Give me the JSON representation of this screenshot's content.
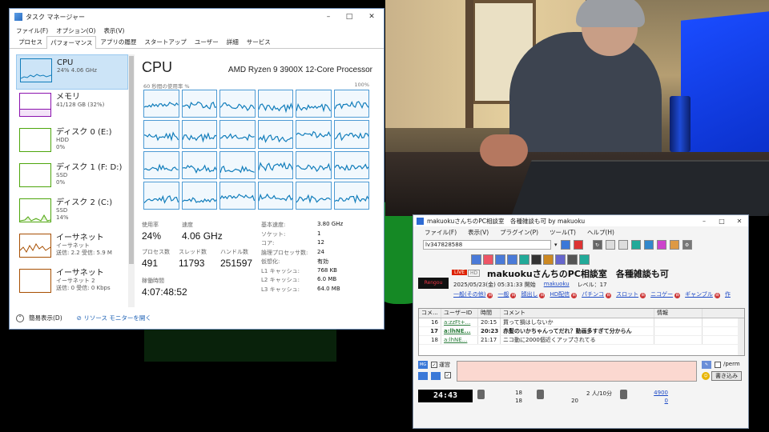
{
  "task_manager": {
    "window_title": "タスク マネージャー",
    "window_controls": {
      "minimize": "–",
      "maximize": "□",
      "close": "✕"
    },
    "menu": [
      "ファイル(F)",
      "オプション(O)",
      "表示(V)"
    ],
    "tabs": [
      "プロセス",
      "パフォーマンス",
      "アプリの履歴",
      "スタートアップ",
      "ユーザー",
      "詳細",
      "サービス"
    ],
    "active_tab": "パフォーマンス",
    "resources": [
      {
        "name": "CPU",
        "sub1": "24% 4.06 GHz",
        "sub2": "",
        "sub3": "",
        "color": "#117dbb"
      },
      {
        "name": "メモリ",
        "sub1": "41/128 GB (32%)",
        "sub2": "",
        "sub3": "",
        "color": "#8b12ae"
      },
      {
        "name": "ディスク 0 (E:)",
        "sub1": "HDD",
        "sub2": "0%",
        "sub3": "",
        "color": "#4da60c"
      },
      {
        "name": "ディスク 1 (F: D:)",
        "sub1": "SSD",
        "sub2": "0%",
        "sub3": "",
        "color": "#4da60c"
      },
      {
        "name": "ディスク 2 (C:)",
        "sub1": "SSD",
        "sub2": "14%",
        "sub3": "",
        "color": "#4da60c"
      },
      {
        "name": "イーサネット",
        "sub1": "イーサネット",
        "sub2": "送信: 2.2  受信: 5.9 M",
        "sub3": "",
        "color": "#a74f01"
      },
      {
        "name": "イーサネット",
        "sub1": "イーサネット 2",
        "sub2": "送信: 0  受信: 0 Kbps",
        "sub3": "",
        "color": "#a74f01"
      }
    ],
    "cpu": {
      "title": "CPU",
      "model": "AMD Ryzen 9 3900X 12-Core Processor",
      "graph_caption_left": "60 秒間の使用率 %",
      "graph_caption_right": "100%",
      "usage_label": "使用率",
      "usage_value": "24%",
      "speed_label": "速度",
      "speed_value": "4.06 GHz",
      "processes_label": "プロセス数",
      "processes_value": "491",
      "threads_label": "スレッド数",
      "threads_value": "11793",
      "handles_label": "ハンドル数",
      "handles_value": "251597",
      "uptime_label": "稼働時間",
      "uptime_value": "4:07:48:52",
      "specs": [
        {
          "k": "基本速度:",
          "v": "3.80 GHz"
        },
        {
          "k": "ソケット:",
          "v": "1"
        },
        {
          "k": "コア:",
          "v": "12"
        },
        {
          "k": "論理プロセッサ数:",
          "v": "24"
        },
        {
          "k": "仮想化:",
          "v": "有効"
        },
        {
          "k": "L1 キャッシュ:",
          "v": "768 KB"
        },
        {
          "k": "L2 キャッシュ:",
          "v": "6.0 MB"
        },
        {
          "k": "L3 キャッシュ:",
          "v": "64.0 MB"
        }
      ]
    },
    "footer": {
      "fewer_details": "簡易表示(D)",
      "resource_monitor": "リソース モニターを開く"
    }
  },
  "comment_viewer": {
    "window_title": "makuokuさんちのPC相談室　各種雑談も可 by makuoku",
    "window_controls": {
      "minimize": "–",
      "maximize": "□",
      "close": "✕"
    },
    "menu": [
      "ファイル(F)",
      "表示(V)",
      "プラグイン(P)",
      "ツール(T)",
      "ヘルプ(H)"
    ],
    "live_id": "lv347828588",
    "badges": {
      "live": "LIVE",
      "hd": "HD"
    },
    "logo_text": "Rengou",
    "room_title": "makuokuさんちのPC相談室　各種雑談も可",
    "started": "2025/05/23(金) 05:31:33 開始",
    "owner": "makuoku",
    "level": "レベル：17",
    "tags": [
      "一般(その他)",
      "一般",
      "顔出し",
      "HD配信",
      "パチンコ",
      "スロット",
      "ニコゲー",
      "ギャンブル",
      "作"
    ],
    "table_headers": [
      "コメ...",
      "ユーザーID",
      "時間",
      "コメント",
      "情報"
    ],
    "comments": [
      {
        "no": "16",
        "user": "a:zzFt+...",
        "time": "20:15",
        "text": "買って損はしないか",
        "info": "",
        "bold": false
      },
      {
        "no": "17",
        "user": "a:lhNE...",
        "time": "20:23",
        "text": "赤髪のいかちゃんってだれ？動画多すぎて分からん",
        "info": "",
        "bold": true
      },
      {
        "no": "18",
        "user": "a:lhNE...",
        "time": "21:17",
        "text": "ニコ動に2000個近くアップされてる",
        "info": "",
        "bold": false
      }
    ],
    "input": {
      "anonymous_label": "運営",
      "perm_label": "/perm",
      "post_button": "書き込み",
      "value": ""
    },
    "status": {
      "timer": "24:43",
      "comments_a": "18",
      "comments_b": "18",
      "viewers_a": "2 人/10分",
      "viewers_b": "20",
      "points_a": "4900",
      "points_b": "0"
    }
  }
}
